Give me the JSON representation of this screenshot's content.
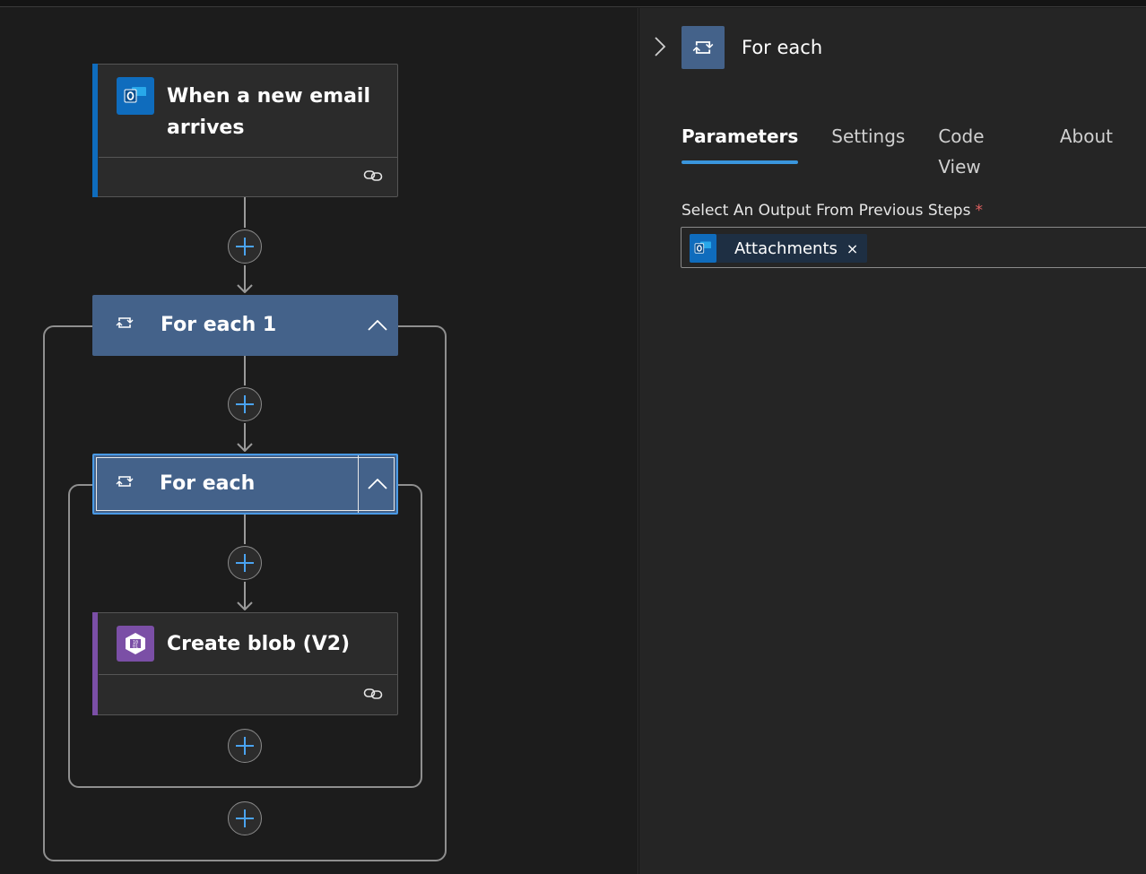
{
  "workflow": {
    "trigger": {
      "title": "When a new email arrives",
      "accent": "#0f6cbd"
    },
    "outer_loop": {
      "label": "For each 1"
    },
    "inner_loop": {
      "label": "For each"
    },
    "action": {
      "title": "Create blob (V2)",
      "accent": "#7b4fa6"
    }
  },
  "panel": {
    "title": "For each",
    "tabs": [
      {
        "label": "Parameters",
        "active": true
      },
      {
        "label": "Settings"
      },
      {
        "label": "Code View"
      },
      {
        "label": "About"
      }
    ],
    "field": {
      "label": "Select An Output From Previous Steps",
      "required": "*",
      "token": {
        "label": "Attachments",
        "close": "×"
      }
    }
  },
  "colors": {
    "loop_header": "#44628a",
    "selection": "#4a9ae6",
    "add_plus": "#4aa3f0",
    "outlook_blue": "#0f6cbd",
    "blob_purple": "#7b4fa6"
  }
}
